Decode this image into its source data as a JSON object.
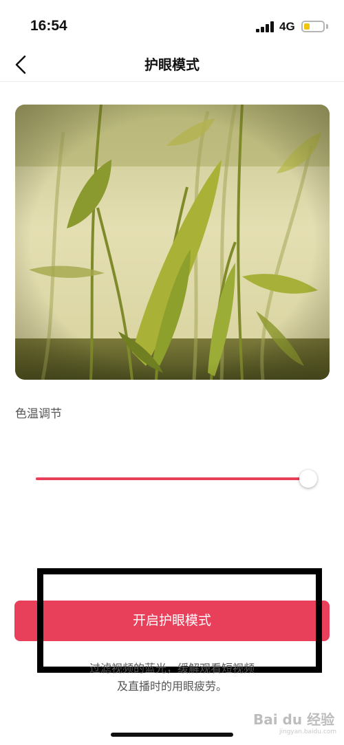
{
  "status_bar": {
    "time": "16:54",
    "network": "4G",
    "battery_level": 0.3,
    "icons": [
      "signal-icon",
      "battery-icon"
    ]
  },
  "nav": {
    "title": "护眼模式",
    "back_icon": "chevron-left-icon"
  },
  "preview": {
    "icon": "photo-preview-image"
  },
  "color_temperature": {
    "label": "色温调节",
    "value": 1.0,
    "accent_color": "#e8405a"
  },
  "action": {
    "enable_button_label": "开启护眼模式",
    "button_color": "#e8405a"
  },
  "description": {
    "line1": "过滤视频的蓝光，缓解观看短视频",
    "line2": "及直播时的用眼疲劳。"
  },
  "watermark": {
    "text": "Bai du 经验",
    "subtext": "jingyan.baidu.com"
  }
}
